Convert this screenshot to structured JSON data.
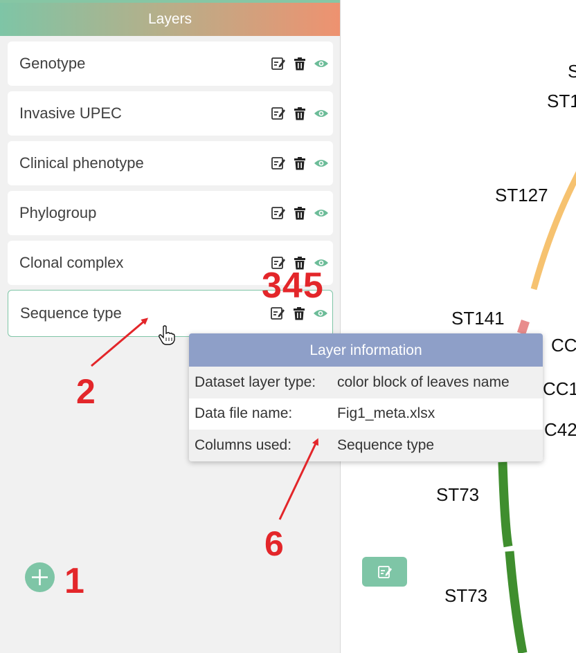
{
  "panel": {
    "title": "Layers",
    "layers": [
      {
        "label": "Genotype"
      },
      {
        "label": "Invasive UPEC"
      },
      {
        "label": "Clinical phenotype"
      },
      {
        "label": "Phylogroup"
      },
      {
        "label": "Clonal complex"
      },
      {
        "label": "Sequence type"
      }
    ]
  },
  "tooltip": {
    "title": "Layer information",
    "rows": [
      {
        "key": "Dataset layer type:",
        "value": "color block of leaves name"
      },
      {
        "key": "Data file name:",
        "value": "Fig1_meta.xlsx"
      },
      {
        "key": "Columns used:",
        "value": "Sequence type"
      }
    ]
  },
  "annotations": {
    "a1": "1",
    "a2": "2",
    "a345": "345",
    "a6": "6"
  },
  "tree_labels": {
    "l0": "S",
    "l1": "ST1",
    "l2": "ST127",
    "l3": "ST141",
    "l4": "CC",
    "l5": "CC1",
    "l6": "C42",
    "l7": "ST73",
    "l8": "ST73"
  },
  "icons": {
    "edit": "edit-icon",
    "delete": "trash-icon",
    "visibility": "eye-icon",
    "add": "plus-icon",
    "cursor": "hand-pointer-icon"
  },
  "colors": {
    "accent": "#7ec5a6",
    "header_gradient_start": "#7ec5a6",
    "header_gradient_end": "#ee9270",
    "tooltip_header": "#8e9fc8",
    "annotation": "#e3262a",
    "st127_band": "#f6c270",
    "st141_band": "#e88c8c",
    "st73_band": "#3f8e2e"
  }
}
